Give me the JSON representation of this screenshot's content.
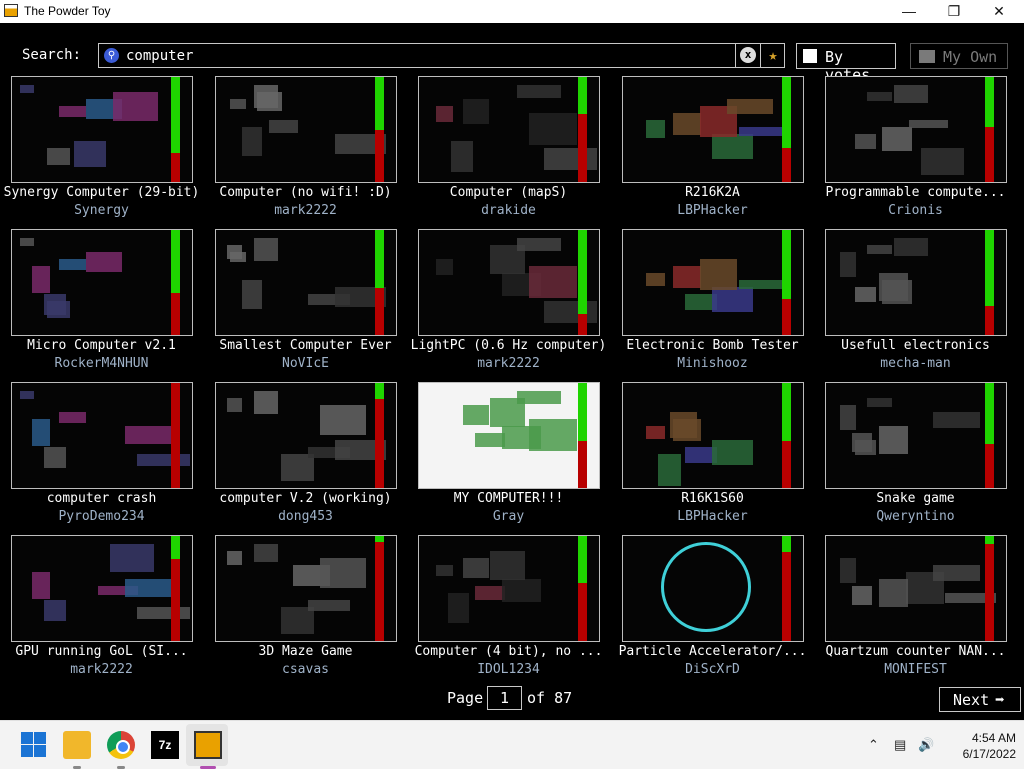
{
  "window": {
    "title": "The Powder Toy",
    "minimize": "—",
    "maximize": "❐",
    "close": "✕"
  },
  "search": {
    "label": "Search:",
    "value": "computer",
    "clear_icon": "x",
    "favorite_icon": "★"
  },
  "sort": {
    "label": "By votes"
  },
  "my_own": {
    "label": "My Own"
  },
  "saves": [
    {
      "name": "Synergy Computer (29-bit)",
      "author": "Synergy",
      "up": 0.72
    },
    {
      "name": "Computer (no wifi! :D)",
      "author": "mark2222",
      "up": 0.5
    },
    {
      "name": "Computer (mapS)",
      "author": "drakide",
      "up": 0.35
    },
    {
      "name": "R216K2A",
      "author": "LBPHacker",
      "up": 0.68
    },
    {
      "name": "Programmable compute...",
      "author": "Crionis",
      "up": 0.48
    },
    {
      "name": "Micro Computer v2.1",
      "author": "RockerM4NHUN",
      "up": 0.6
    },
    {
      "name": "Smallest Computer Ever",
      "author": "NoVIcE",
      "up": 0.55
    },
    {
      "name": "LightPC (0.6 Hz computer)",
      "author": "mark2222",
      "up": 0.8
    },
    {
      "name": "Electronic Bomb Tester",
      "author": "Minishooz",
      "up": 0.66
    },
    {
      "name": "Usefull electronics",
      "author": "mecha-man",
      "up": 0.72
    },
    {
      "name": "computer crash",
      "author": "PyroDemo234",
      "up": 0.0
    },
    {
      "name": "computer V.2 (working)",
      "author": "dong453",
      "up": 0.15
    },
    {
      "name": "MY COMPUTER!!!",
      "author": "Gray",
      "up": 0.55
    },
    {
      "name": "R16K1S60",
      "author": "LBPHacker",
      "up": 0.55
    },
    {
      "name": "Snake game",
      "author": "Qweryntino",
      "up": 0.58
    },
    {
      "name": "GPU running GoL (SI...",
      "author": "mark2222",
      "up": 0.22
    },
    {
      "name": "3D Maze Game",
      "author": "csavas",
      "up": 0.06
    },
    {
      "name": "Computer (4 bit), no ...",
      "author": "IDOL1234",
      "up": 0.45
    },
    {
      "name": "Particle Accelerator/...",
      "author": "DiScXrD",
      "up": 0.15
    },
    {
      "name": "Quartzum counter NAN...",
      "author": "MONIFEST",
      "up": 0.08
    }
  ],
  "pager": {
    "page_label": "Page",
    "page": "1",
    "of_label": "of 87",
    "next_label": "Next",
    "next_icon": "➡"
  },
  "taskbar": {
    "seven_zip_label": "7z",
    "time": "4:54 AM",
    "date": "6/17/2022"
  },
  "colors": {
    "vote_up": "#1fd400",
    "vote_down": "#b80000",
    "author": "#9fb2c8"
  }
}
